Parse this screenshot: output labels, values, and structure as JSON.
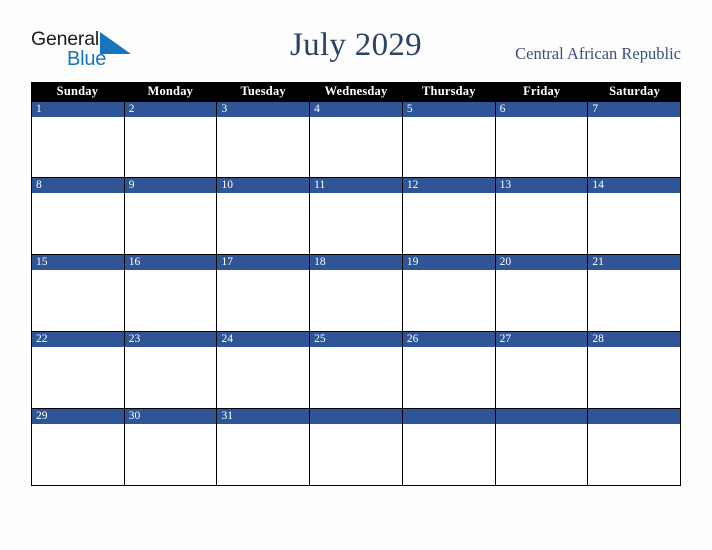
{
  "logo": {
    "text_top": "General",
    "text_bottom": "Blue",
    "icon": "triangle-icon",
    "color_top": "#1d1d1d",
    "color_bottom": "#1576bd",
    "triangle_color": "#1576bd"
  },
  "header": {
    "title": "July 2029",
    "country": "Central African Republic",
    "title_color": "#2c4262",
    "country_color": "#39527a"
  },
  "calendar": {
    "accent_color": "#2f5596",
    "header_background": "#000000",
    "header_text_color": "#ffffff",
    "weekdays": [
      "Sunday",
      "Monday",
      "Tuesday",
      "Wednesday",
      "Thursday",
      "Friday",
      "Saturday"
    ],
    "weeks": [
      [
        {
          "date": "1"
        },
        {
          "date": "2"
        },
        {
          "date": "3"
        },
        {
          "date": "4"
        },
        {
          "date": "5"
        },
        {
          "date": "6"
        },
        {
          "date": "7"
        }
      ],
      [
        {
          "date": "8"
        },
        {
          "date": "9"
        },
        {
          "date": "10"
        },
        {
          "date": "11"
        },
        {
          "date": "12"
        },
        {
          "date": "13"
        },
        {
          "date": "14"
        }
      ],
      [
        {
          "date": "15"
        },
        {
          "date": "16"
        },
        {
          "date": "17"
        },
        {
          "date": "18"
        },
        {
          "date": "19"
        },
        {
          "date": "20"
        },
        {
          "date": "21"
        }
      ],
      [
        {
          "date": "22"
        },
        {
          "date": "23"
        },
        {
          "date": "24"
        },
        {
          "date": "25"
        },
        {
          "date": "26"
        },
        {
          "date": "27"
        },
        {
          "date": "28"
        }
      ],
      [
        {
          "date": "29"
        },
        {
          "date": "30"
        },
        {
          "date": "31"
        },
        {
          "date": ""
        },
        {
          "date": ""
        },
        {
          "date": ""
        },
        {
          "date": ""
        }
      ]
    ]
  }
}
